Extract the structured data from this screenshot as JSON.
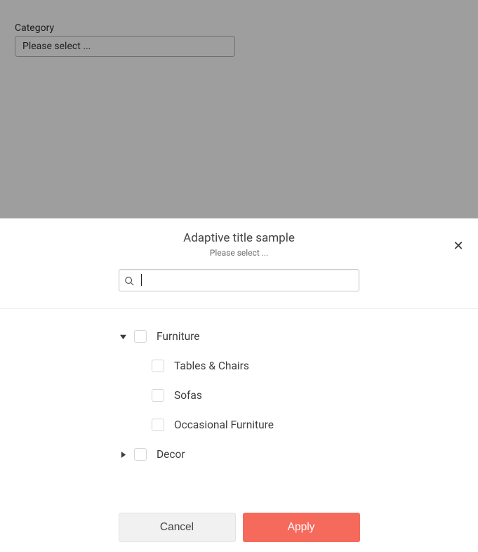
{
  "background": {
    "field_label": "Category",
    "select_placeholder": "Please select ..."
  },
  "modal": {
    "title": "Adaptive title sample",
    "subtitle": "Please select ...",
    "close_glyph": "✕",
    "search": {
      "placeholder": ""
    },
    "tree": {
      "root1": {
        "label": "Furniture",
        "expanded": true
      },
      "root1_children": [
        {
          "label": "Tables & Chairs"
        },
        {
          "label": "Sofas"
        },
        {
          "label": "Occasional Furniture"
        }
      ],
      "root2": {
        "label": "Decor",
        "expanded": false
      }
    },
    "buttons": {
      "cancel": "Cancel",
      "apply": "Apply"
    }
  }
}
